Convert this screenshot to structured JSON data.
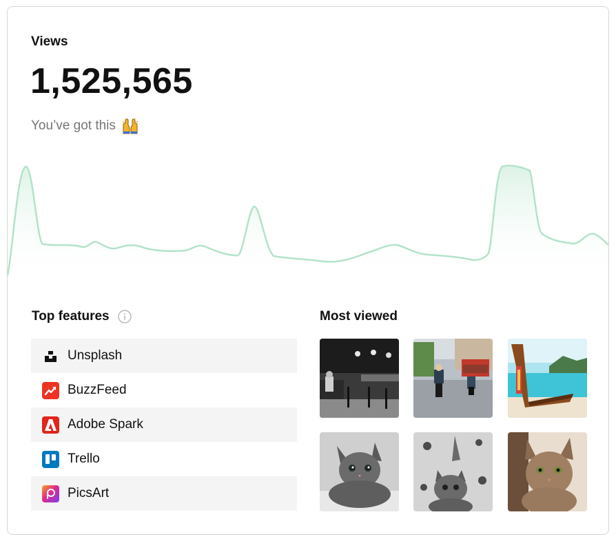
{
  "views": {
    "label": "Views",
    "count": "1,525,565",
    "subtitle": "You’ve got this",
    "emoji": "raising-hands-emoji"
  },
  "colors": {
    "line": "#b3e3c9",
    "fill_top": "#d9f1e4",
    "row_shade": "#f4f4f4",
    "muted_text": "#767676"
  },
  "top_features": {
    "title": "Top features",
    "info_icon": "info-icon",
    "items": [
      {
        "label": "Unsplash",
        "icon": "unsplash-logo-icon",
        "color": "#111111"
      },
      {
        "label": "BuzzFeed",
        "icon": "buzzfeed-logo-icon",
        "color": "#ee3322"
      },
      {
        "label": "Adobe Spark",
        "icon": "adobe-logo-icon",
        "color": "#e1251b"
      },
      {
        "label": "Trello",
        "icon": "trello-logo-icon",
        "color": "#0079bf"
      },
      {
        "label": "PicsArt",
        "icon": "picsart-logo-icon",
        "color": "#c13cf0"
      }
    ]
  },
  "most_viewed": {
    "title": "Most viewed",
    "images": [
      "cafe-interior-bw-photo",
      "street-scooters-photo",
      "longtail-boat-beach-photo",
      "kitten-lying-photo",
      "kitten-playing-photo",
      "kitten-portrait-photo"
    ]
  }
}
